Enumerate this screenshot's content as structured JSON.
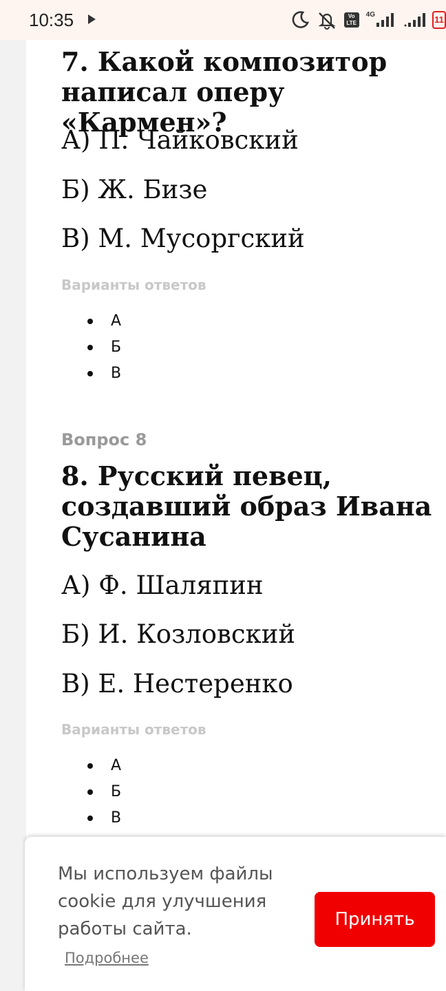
{
  "status_bar": {
    "time": "10:35",
    "network_label": "4G",
    "lte_badge": "Vo LTE",
    "battery_level": "11"
  },
  "questions": [
    {
      "label": "",
      "title": "7. Какой композитор написал оперу «Кармен»?",
      "options": [
        "А) П. Чайковский",
        "Б) Ж. Бизе",
        "В) М. Мусоргский"
      ],
      "variants_label": "Варианты ответов",
      "choices": [
        "А",
        "Б",
        "В"
      ]
    },
    {
      "label": "Вопрос 8",
      "title": "8. Русский певец, создавший образ Ивана Сусанина",
      "options": [
        "А) Ф. Шаляпин",
        "Б) И. Козловский",
        "В) Е. Нестеренко"
      ],
      "variants_label": "Варианты ответов",
      "choices": [
        "А",
        "Б",
        "В"
      ]
    }
  ],
  "cookie_banner": {
    "text": "Мы используем файлы cookie для улучшения работы сайта.",
    "accept_label": "Принять",
    "more_label": "Подробнее"
  },
  "colors": {
    "accent": "#f00000",
    "status_bar_bg": "#fff5f0",
    "muted_label": "#c8c8c8"
  }
}
